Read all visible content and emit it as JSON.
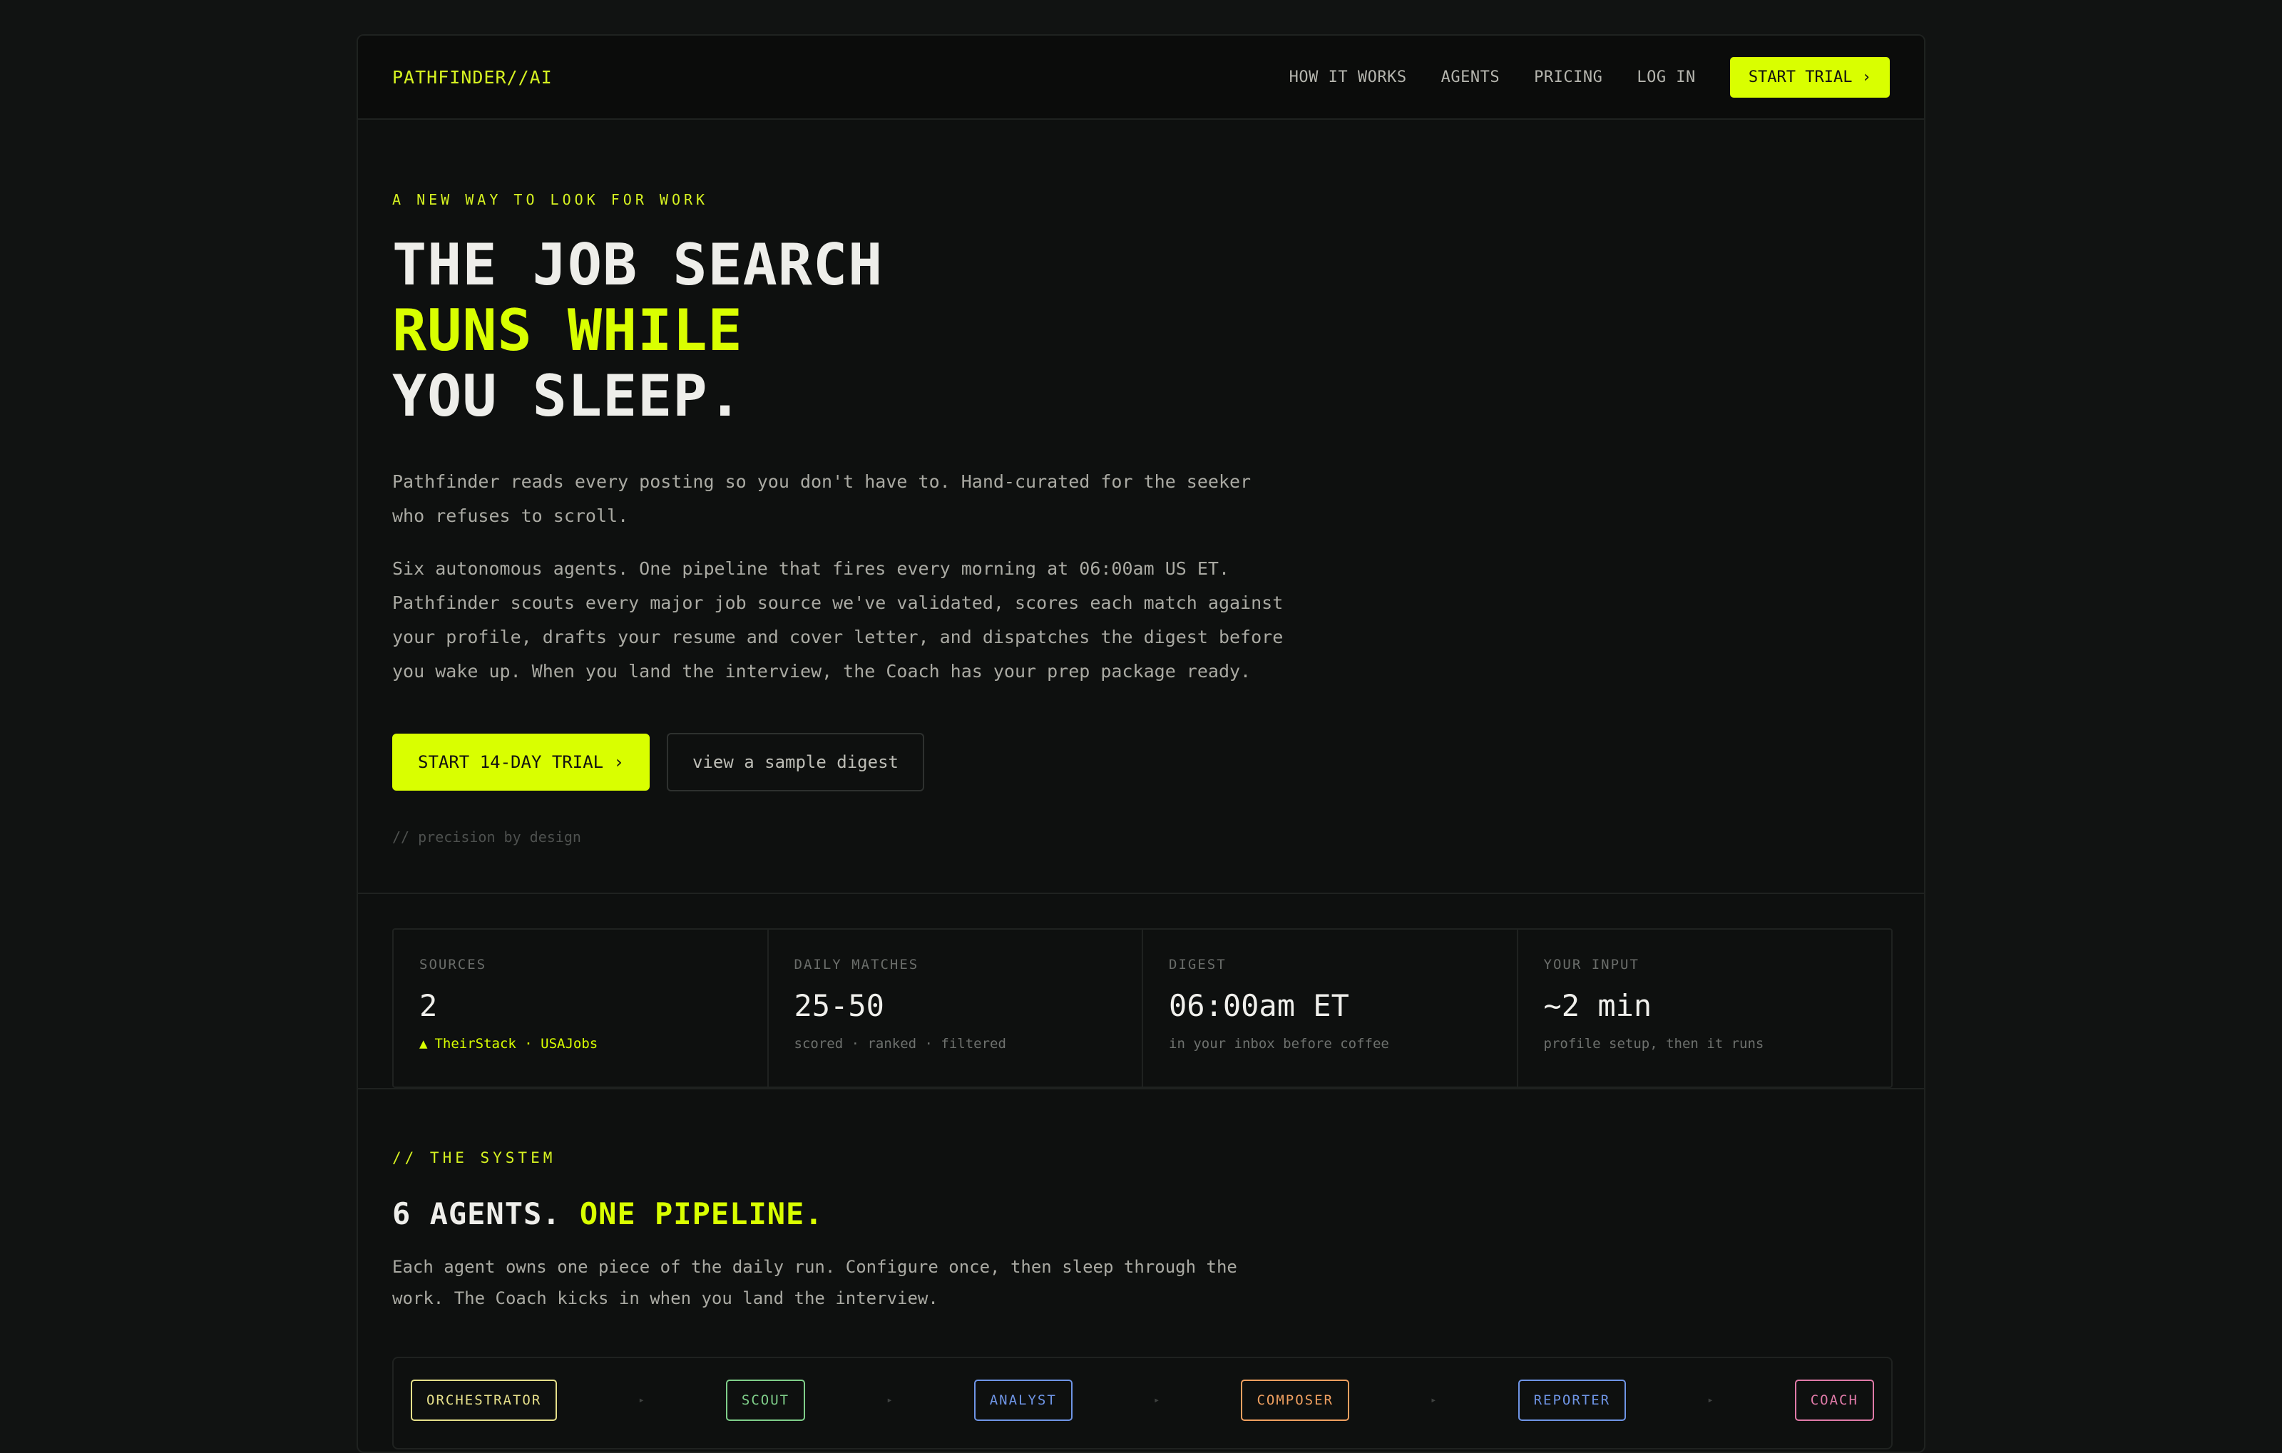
{
  "nav": {
    "logo": "PATHFINDER//AI",
    "links": [
      "HOW IT WORKS",
      "AGENTS",
      "PRICING",
      "LOG IN"
    ],
    "cta": "START TRIAL ›"
  },
  "hero": {
    "eyebrow": "A NEW WAY TO LOOK FOR WORK",
    "headline_1": "THE JOB SEARCH",
    "headline_2": "RUNS WHILE",
    "headline_3": "YOU SLEEP.",
    "para_1": "Pathfinder reads every posting so you don't have to. Hand-curated for the seeker who refuses to scroll.",
    "para_2": "Six autonomous agents. One pipeline that fires every morning at 06:00am US ET. Pathfinder scouts every major job source we've validated, scores each match against your profile, drafts your resume and cover letter, and dispatches the digest before you wake up. When you land the interview, the Coach has your prep package ready.",
    "primary_cta": "START 14-DAY TRIAL ›",
    "secondary_cta": "view a sample digest",
    "comment": "// precision by design"
  },
  "stats": [
    {
      "label": "SOURCES",
      "value": "2",
      "sub": "TheirStack · USAJobs",
      "icon": "triangle-up-icon"
    },
    {
      "label": "DAILY MATCHES",
      "value": "25-50",
      "sub": "scored · ranked · filtered"
    },
    {
      "label": "DIGEST",
      "value": "06:00am ET",
      "sub": "in your inbox before coffee"
    },
    {
      "label": "YOUR INPUT",
      "value": "~2 min",
      "sub": "profile setup, then it runs"
    }
  ],
  "system": {
    "eyebrow": "// THE SYSTEM",
    "title_1": "6 AGENTS.",
    "title_2": "ONE PIPELINE.",
    "desc": "Each agent owns one piece of the daily run. Configure once, then sleep through the work. The Coach kicks in when you land the interview.",
    "agents": [
      {
        "name": "ORCHESTRATOR",
        "color": "#e6e08a"
      },
      {
        "name": "SCOUT",
        "color": "#7fcf8a"
      },
      {
        "name": "ANALYST",
        "color": "#6f95e6"
      },
      {
        "name": "COMPOSER",
        "color": "#f0a060"
      },
      {
        "name": "REPORTER",
        "color": "#6f95e6"
      },
      {
        "name": "COACH",
        "color": "#e07aa8"
      }
    ],
    "arrow": "▸"
  },
  "colors": {
    "accent": "#d9ff00",
    "background": "#111312"
  }
}
